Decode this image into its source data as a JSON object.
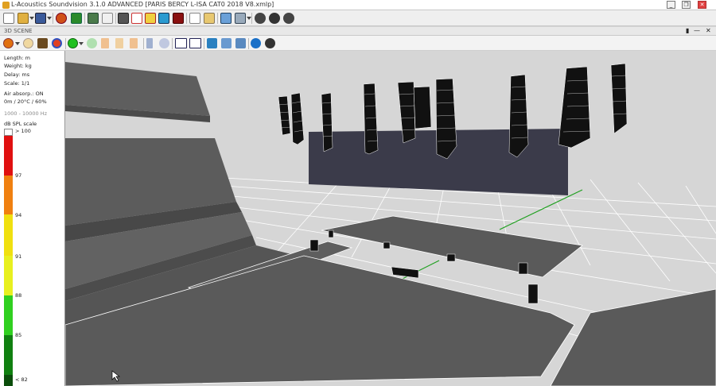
{
  "window": {
    "title": "L-Acoustics Soundvision 3.1.0 ADVANCED [PARIS BERCY L-ISA CAT0 2018 V8.xmlp]",
    "controls": [
      "_",
      "❐",
      "✕"
    ]
  },
  "panel": {
    "title": "3D SCENE",
    "controls": [
      "▮",
      "—",
      "✕"
    ]
  },
  "side_panel": {
    "length_unit": "Length: m",
    "weight_unit": "Weight: kg",
    "delay_unit": "Delay: ms",
    "scale": "Scale: 1/1",
    "air_absorption": "Air absorp.: ON",
    "air_conditions": "0m / 20°C / 60%",
    "frequency_range": "1000 - 10000 Hz",
    "spl_scale_title": "dB SPL scale",
    "spl_labels": [
      "> 100",
      "97",
      "94",
      "91",
      "88",
      "85",
      "< 82"
    ],
    "spl_colors": [
      "#ffffff",
      "#e01010",
      "#f08010",
      "#f0e010",
      "#e8f020",
      "#30d020",
      "#108010",
      "#0b4d0b"
    ]
  },
  "toolbar_icons": [
    "new-file-icon",
    "open-folder-icon",
    "save-icon",
    "source-icon",
    "leaf-icon",
    "image-icon",
    "pencil-icon",
    "layers-icon",
    "frame-icon",
    "frame-mapping-icon",
    "frame-spl-icon",
    "record-icon",
    "report-icon",
    "export-icon",
    "align-icon",
    "grid-icon",
    "settings-icon",
    "help-icon",
    "more-icon"
  ],
  "scene_icons": [
    "color-picker-icon",
    "light-icon",
    "box-icon",
    "sphere-icon",
    "spl-mode-icon",
    "spl-hidden-icon",
    "tree-icon",
    "graph-icon",
    "tree-alt-icon",
    "pillar-icon",
    "radar-icon",
    "view-plan-icon",
    "view-section-icon",
    "screenshot-icon",
    "walk-icon",
    "walk-alt-icon",
    "info-icon",
    "help-icon"
  ]
}
